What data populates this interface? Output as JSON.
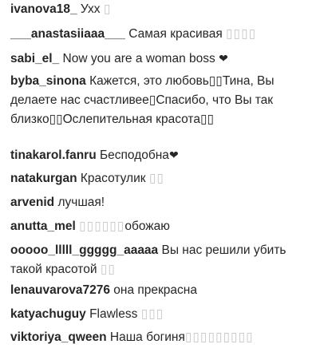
{
  "comments": [
    {
      "user": "ivanova18_",
      "text": "Ухх",
      "glyphs": "▯"
    },
    {
      "user": "___anastasiiaaa___",
      "text": "Самая красивая",
      "glyphs": "▯▯▯▯"
    },
    {
      "user": "sabi_el_",
      "text": "Now you are a woman boss",
      "glyphs": "",
      "heart": "❤"
    },
    {
      "user": "byba_sinona",
      "text": "Кажется, это любовь▯▯Тина, Вы делаете нас счастливее▯Спасибо, что Вы так близко▯▯Ослепительная красота▯▯",
      "glyphs": ""
    },
    {
      "user": "tinakarol.fanru",
      "text": "Бесподобна",
      "glyphs": "",
      "heart": "❤"
    },
    {
      "user": "natakurgan",
      "text": "Красотулик",
      "glyphs": "▯▯"
    },
    {
      "user": "arvenid",
      "text": "лучшая!",
      "glyphs": ""
    },
    {
      "user": "anutta_mel",
      "text": "обожаю",
      "glyphs_before": "▯▯▯▯▯▯"
    },
    {
      "user": "ooooo_lllll_ggggg_aaaaa",
      "text": "Вы нас решили убить такой красотой",
      "glyphs": "▯▯"
    },
    {
      "user": "lenauvarova7276",
      "text": "она прекрасна",
      "glyphs": ""
    },
    {
      "user": "katyachuguy",
      "text": "Flawless",
      "glyphs": "▯▯▯"
    },
    {
      "user": "viktoriya_qween",
      "text": "Наша богиня",
      "glyphs": "▯▯▯▯▯▯▯▯▯"
    }
  ]
}
